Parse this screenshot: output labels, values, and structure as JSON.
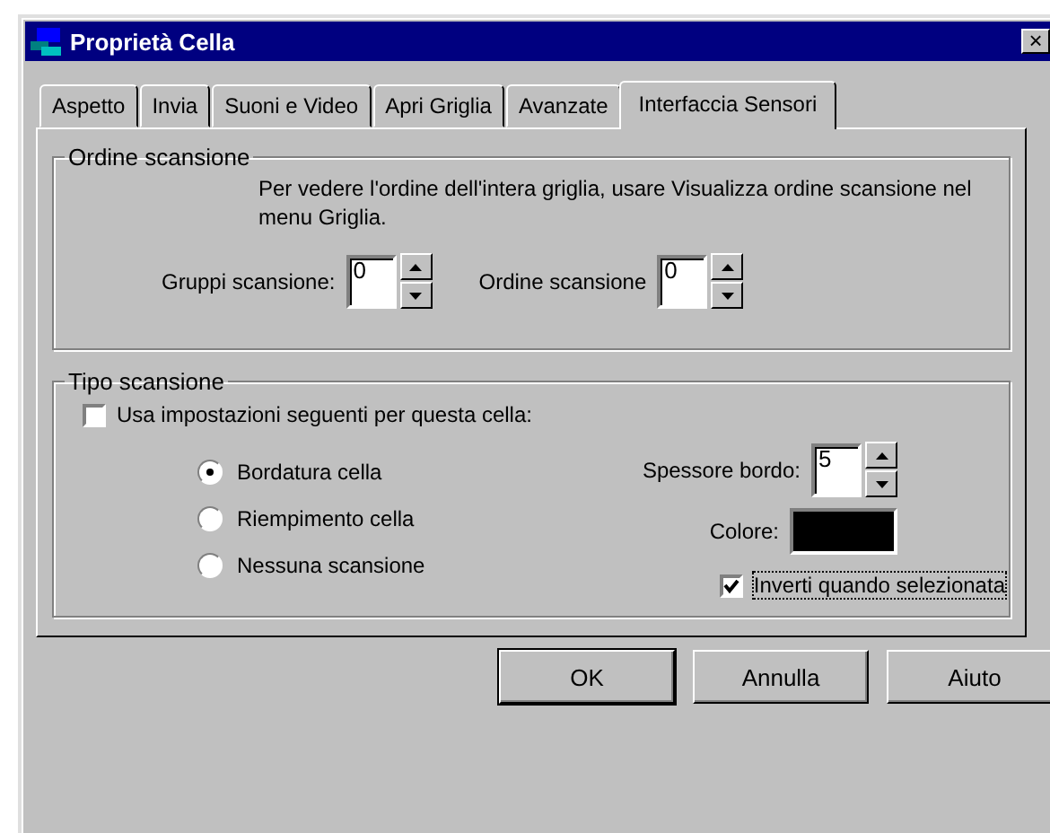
{
  "window": {
    "title": "Proprietà Cella",
    "close": "×"
  },
  "tabs": [
    {
      "label": "Aspetto",
      "selected": false
    },
    {
      "label": "Invia",
      "selected": false
    },
    {
      "label": "Suoni e Video",
      "selected": false
    },
    {
      "label": "Apri Griglia",
      "selected": false
    },
    {
      "label": "Avanzate",
      "selected": false
    },
    {
      "label": "Interfaccia Sensori",
      "selected": true
    }
  ],
  "ordine_scansione": {
    "title": "Ordine scansione",
    "note": "Per vedere l'ordine dell'intera griglia, usare Visualizza ordine scansione nel menu Griglia.",
    "spinners": [
      {
        "label": "Gruppi scansione:",
        "value": "0"
      },
      {
        "label": "Ordine scansione",
        "value": "0"
      }
    ]
  },
  "tipo_scansione": {
    "title": "Tipo scansione",
    "use_settings": {
      "label": "Usa impostazioni seguenti per questa cella:",
      "checked": false
    },
    "radios": [
      {
        "label": "Bordatura cella",
        "selected": true
      },
      {
        "label": "Riempimento cella",
        "selected": false
      },
      {
        "label": "Nessuna scansione",
        "selected": false
      }
    ],
    "spessore": {
      "label": "Spessore bordo:",
      "value": "5"
    },
    "colore": {
      "label": "Colore:",
      "color": "#000000"
    },
    "invert": {
      "label": "Inverti quando selezionata",
      "checked": true
    }
  },
  "buttons": [
    "OK",
    "Annulla",
    "Aiuto"
  ]
}
